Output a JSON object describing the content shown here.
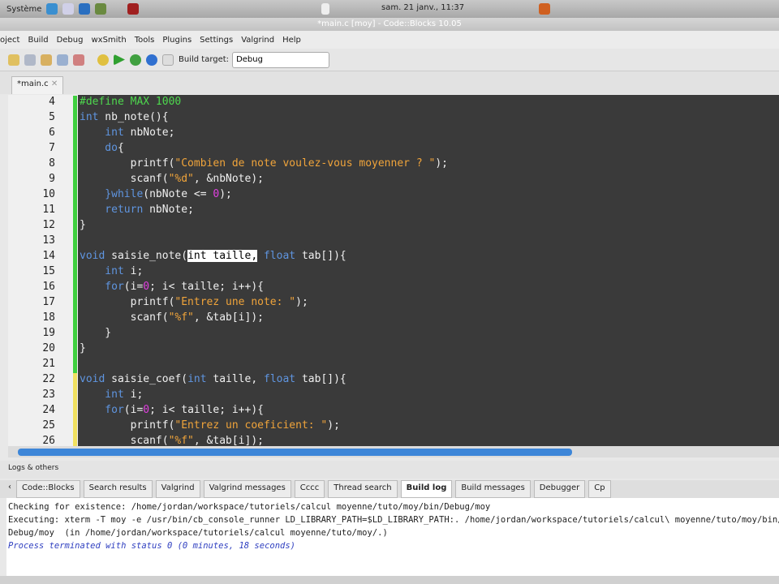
{
  "panel": {
    "menu": "Système",
    "clock": "sam. 21 janv., 11:37"
  },
  "window_title": "*main.c [moy] - Code::Blocks 10.05",
  "menu": [
    "oject",
    "Build",
    "Debug",
    "wxSmith",
    "Tools",
    "Plugins",
    "Settings",
    "Valgrind",
    "Help"
  ],
  "toolbar": {
    "build_target_label": "Build target:",
    "build_target_value": "Debug"
  },
  "editor_tab": "*main.c",
  "code_lines": [
    {
      "n": "4",
      "t": [
        [
          "#define MAX 1000",
          "pp"
        ]
      ]
    },
    {
      "n": "5",
      "t": [
        [
          "int",
          "kw"
        ],
        [
          " nb_note(){",
          ""
        ]
      ]
    },
    {
      "n": "6",
      "t": [
        [
          "    int",
          "kw"
        ],
        [
          " nbNote;",
          ""
        ]
      ]
    },
    {
      "n": "7",
      "t": [
        [
          "    do",
          "kw"
        ],
        [
          "{",
          ""
        ]
      ]
    },
    {
      "n": "8",
      "t": [
        [
          "        printf(",
          ""
        ],
        [
          "\"Combien de note voulez-vous moyenner ? \"",
          "str"
        ],
        [
          ");",
          ""
        ]
      ]
    },
    {
      "n": "9",
      "t": [
        [
          "        scanf(",
          ""
        ],
        [
          "\"%d\"",
          "str"
        ],
        [
          ", &nbNote);",
          ""
        ]
      ]
    },
    {
      "n": "10",
      "t": [
        [
          "    }",
          "kw"
        ],
        [
          "while",
          "kw"
        ],
        [
          "(nbNote <= ",
          ""
        ],
        [
          "0",
          "num"
        ],
        [
          ");",
          ""
        ]
      ]
    },
    {
      "n": "11",
      "t": [
        [
          "    return",
          "kw"
        ],
        [
          " nbNote;",
          ""
        ]
      ]
    },
    {
      "n": "12",
      "t": [
        [
          "}",
          ""
        ]
      ]
    },
    {
      "n": "13",
      "t": [
        [
          "",
          ""
        ]
      ]
    },
    {
      "n": "14",
      "t": [
        [
          "void",
          "kw"
        ],
        [
          " saisie_note(",
          ""
        ],
        [
          "int taille,",
          "sel"
        ],
        [
          " ",
          ""
        ],
        [
          "float",
          "kw"
        ],
        [
          " tab[]){",
          ""
        ]
      ]
    },
    {
      "n": "15",
      "t": [
        [
          "    int",
          "kw"
        ],
        [
          " i;",
          ""
        ]
      ]
    },
    {
      "n": "16",
      "t": [
        [
          "    for",
          "kw"
        ],
        [
          "(i=",
          ""
        ],
        [
          "0",
          "num"
        ],
        [
          "; i< taille; i++){",
          ""
        ]
      ]
    },
    {
      "n": "17",
      "t": [
        [
          "        printf(",
          ""
        ],
        [
          "\"Entrez une note: \"",
          "str"
        ],
        [
          ");",
          ""
        ]
      ]
    },
    {
      "n": "18",
      "t": [
        [
          "        scanf(",
          ""
        ],
        [
          "\"%f\"",
          "str"
        ],
        [
          ", &tab[i]);",
          ""
        ]
      ]
    },
    {
      "n": "19",
      "t": [
        [
          "    }",
          ""
        ]
      ]
    },
    {
      "n": "20",
      "t": [
        [
          "}",
          ""
        ]
      ]
    },
    {
      "n": "21",
      "t": [
        [
          "",
          ""
        ]
      ]
    },
    {
      "n": "22",
      "t": [
        [
          "void",
          "kw"
        ],
        [
          " saisie_coef(",
          ""
        ],
        [
          "int",
          "kw"
        ],
        [
          " taille, ",
          ""
        ],
        [
          "float",
          "kw"
        ],
        [
          " tab[]){",
          ""
        ]
      ]
    },
    {
      "n": "23",
      "t": [
        [
          "    int",
          "kw"
        ],
        [
          " i;",
          ""
        ]
      ]
    },
    {
      "n": "24",
      "t": [
        [
          "    for",
          "kw"
        ],
        [
          "(i=",
          ""
        ],
        [
          "0",
          "num"
        ],
        [
          "; i< taille; i++){",
          ""
        ]
      ]
    },
    {
      "n": "25",
      "t": [
        [
          "        printf(",
          ""
        ],
        [
          "\"Entrez un coeficient: \"",
          "str"
        ],
        [
          ");",
          ""
        ]
      ]
    },
    {
      "n": "26",
      "t": [
        [
          "        scanf(",
          ""
        ],
        [
          "\"%f\"",
          "str"
        ],
        [
          ", &tab[i]);",
          ""
        ]
      ]
    }
  ],
  "logs": {
    "header": "Logs & others",
    "tabs": [
      "Code::Blocks",
      "Search results",
      "Valgrind",
      "Valgrind messages",
      "Cccc",
      "Thread search",
      "Build log",
      "Build messages",
      "Debugger",
      "Cp"
    ],
    "active_tab": "Build log",
    "lines": [
      "Checking for existence: /home/jordan/workspace/tutoriels/calcul moyenne/tuto/moy/bin/Debug/moy",
      "Executing: xterm -T moy -e /usr/bin/cb_console_runner LD_LIBRARY_PATH=$LD_LIBRARY_PATH:. /home/jordan/workspace/tutoriels/calcul\\ moyenne/tuto/moy/bin/",
      "Debug/moy  (in /home/jordan/workspace/tutoriels/calcul moyenne/tuto/moy/.)",
      "Process terminated with status 0 (0 minutes, 18 seconds)"
    ]
  }
}
